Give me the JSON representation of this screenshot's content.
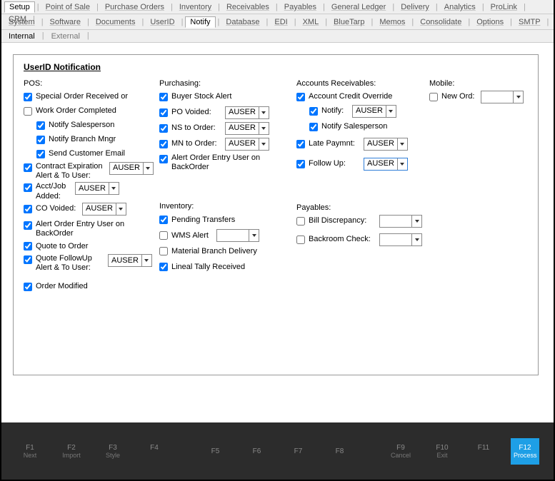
{
  "topnav": {
    "items": [
      "Setup",
      "Point of Sale",
      "Purchase Orders",
      "Inventory",
      "Receivables",
      "Payables",
      "General Ledger",
      "Delivery",
      "Analytics",
      "ProLink",
      "CRM"
    ],
    "active_index": 0
  },
  "subnav": {
    "items": [
      "System",
      "Software",
      "Documents",
      "UserID",
      "Notify",
      "Database",
      "EDI",
      "XML",
      "BlueTarp",
      "Memos",
      "Consolidate",
      "Options",
      "SMTP"
    ],
    "active_index": 4
  },
  "tabs": {
    "items": [
      "Internal",
      "External"
    ],
    "active_index": 0
  },
  "group_title": "UserID Notification",
  "pos": {
    "head": "POS:",
    "special_order": {
      "label": "Special Order Received or",
      "checked": true
    },
    "wo_completed": {
      "label": "Work Order Completed",
      "checked": false
    },
    "notify_sales": {
      "label": "Notify Salesperson",
      "checked": true
    },
    "notify_branch": {
      "label": "Notify Branch Mngr",
      "checked": true
    },
    "send_cust_email": {
      "label": "Send Customer Email",
      "checked": true
    },
    "contract_exp": {
      "label": "Contract Expiration Alert & To User:",
      "checked": true,
      "user": "AUSER"
    },
    "acct_job": {
      "label": "Acct/Job Added:",
      "checked": true,
      "user": "AUSER"
    },
    "co_voided": {
      "label": "CO Voided:",
      "checked": true,
      "user": "AUSER"
    },
    "alert_order_entry": {
      "label": "Alert Order Entry User on BackOrder",
      "checked": true
    },
    "quote_to_order": {
      "label": "Quote to Order",
      "checked": true
    },
    "quote_followup": {
      "label": "Quote FollowUp Alert & To User:",
      "checked": true,
      "user": "AUSER"
    },
    "order_modified": {
      "label": "Order Modified",
      "checked": true
    }
  },
  "purchasing": {
    "head": "Purchasing:",
    "buyer_stock_alert": {
      "label": "Buyer Stock Alert",
      "checked": true
    },
    "po_voided": {
      "label": "PO Voided:",
      "checked": true,
      "user": "AUSER"
    },
    "ns_to_order": {
      "label": "NS to Order:",
      "checked": true,
      "user": "AUSER"
    },
    "mn_to_order": {
      "label": "MN to Order:",
      "checked": true,
      "user": "AUSER"
    },
    "alert_order_entry": {
      "label": "Alert Order Entry User on BackOrder",
      "checked": true
    }
  },
  "inventory": {
    "head": "Inventory:",
    "pending_transfers": {
      "label": "Pending Transfers",
      "checked": true
    },
    "wms_alert": {
      "label": "WMS Alert",
      "checked": false,
      "user": ""
    },
    "material_branch": {
      "label": "Material Branch Delivery",
      "checked": false
    },
    "lineal_tally": {
      "label": "Lineal Tally Received",
      "checked": true
    }
  },
  "ar": {
    "head": "Accounts Receivables:",
    "acct_credit_override": {
      "label": "Account Credit Override",
      "checked": true
    },
    "notify": {
      "label": "Notify:",
      "checked": true,
      "user": "AUSER"
    },
    "notify_sales": {
      "label": "Notify Salesperson",
      "checked": true
    },
    "late_paymnt": {
      "label": "Late Paymnt:",
      "checked": true,
      "user": "AUSER"
    },
    "follow_up": {
      "label": "Follow Up:",
      "checked": true,
      "user": "AUSER"
    }
  },
  "payables": {
    "head": "Payables:",
    "bill_discrepancy": {
      "label": "Bill Discrepancy:",
      "checked": false,
      "user": ""
    },
    "backroom_check": {
      "label": "Backroom Check:",
      "checked": false,
      "user": ""
    }
  },
  "mobile": {
    "head": "Mobile:",
    "new_ord": {
      "label": "New Ord:",
      "checked": false,
      "user": ""
    }
  },
  "footer": {
    "f1": {
      "key": "F1",
      "label": "Next"
    },
    "f2": {
      "key": "F2",
      "label": "Import"
    },
    "f3": {
      "key": "F3",
      "label": "Style"
    },
    "f4": {
      "key": "F4",
      "label": ""
    },
    "f5": {
      "key": "F5",
      "label": ""
    },
    "f6": {
      "key": "F6",
      "label": ""
    },
    "f7": {
      "key": "F7",
      "label": ""
    },
    "f8": {
      "key": "F8",
      "label": ""
    },
    "f9": {
      "key": "F9",
      "label": "Cancel"
    },
    "f10": {
      "key": "F10",
      "label": "Exit"
    },
    "f11": {
      "key": "F11",
      "label": ""
    },
    "f12": {
      "key": "F12",
      "label": "Process"
    }
  }
}
